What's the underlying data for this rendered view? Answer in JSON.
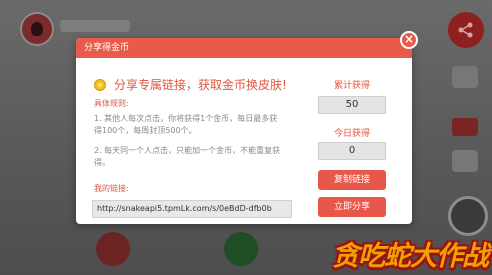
{
  "dialog": {
    "header_title": "分享得金币",
    "close_symbol": "×",
    "headline": "分享专属链接，获取金币换皮肤!",
    "rules_title": "具体规则:",
    "rule_1": "1. 其他人每次点击，你将获得1个金币，每日最多获得100个，每周封顶500个。",
    "rule_2": "2. 每天同一个人点击，只能加一个金币，不能重复获得。",
    "link_title": "我的链接:",
    "link_value": "http://snakeapi5.tpmLk.com/s/0eBdD-dfb0b",
    "total_label": "累计获得",
    "total_value": "50",
    "today_label": "今日获得",
    "today_value": "0",
    "copy_button": "复制链接",
    "share_button": "立即分享"
  },
  "watermark": "贪吃蛇大作战",
  "colors": {
    "accent": "#e85b4a",
    "watermark_fill": "#f0a000",
    "watermark_outline": "#9b1212"
  }
}
